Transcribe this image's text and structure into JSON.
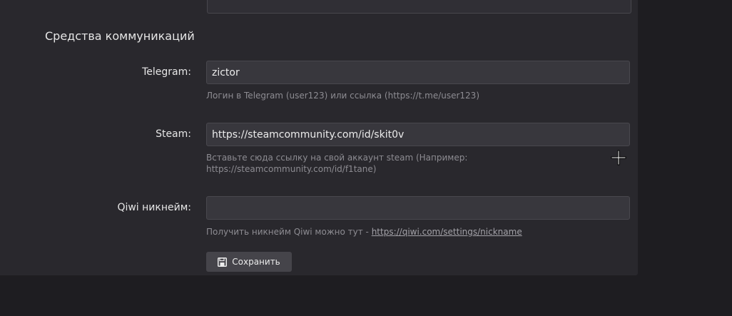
{
  "section": {
    "title": "Средства коммуникаций"
  },
  "telegram": {
    "label": "Telegram:",
    "value": "zictor",
    "help": "Логин в Telegram (user123) или ссылка (https://t.me/user123)"
  },
  "steam": {
    "label": "Steam:",
    "value": "https://steamcommunity.com/id/skit0v",
    "help_line1": "Вставьте сюда ссылку на свой аккаунт steam (Например:",
    "help_line2": "https://steamcommunity.com/id/f1tane)"
  },
  "qiwi": {
    "label": "Qiwi никнейм:",
    "value": "",
    "help_prefix": "Получить никнейм Qiwi можно тут - ",
    "help_link": "https://qiwi.com/settings/nickname"
  },
  "actions": {
    "save_label": "Сохранить",
    "save_icon": "floppy-disk-icon"
  },
  "colors": {
    "page_background": "#1e1d21",
    "panel_background": "#29282d",
    "input_background": "#38373d",
    "button_background": "#45444a",
    "help_text": "#8d8c92"
  }
}
